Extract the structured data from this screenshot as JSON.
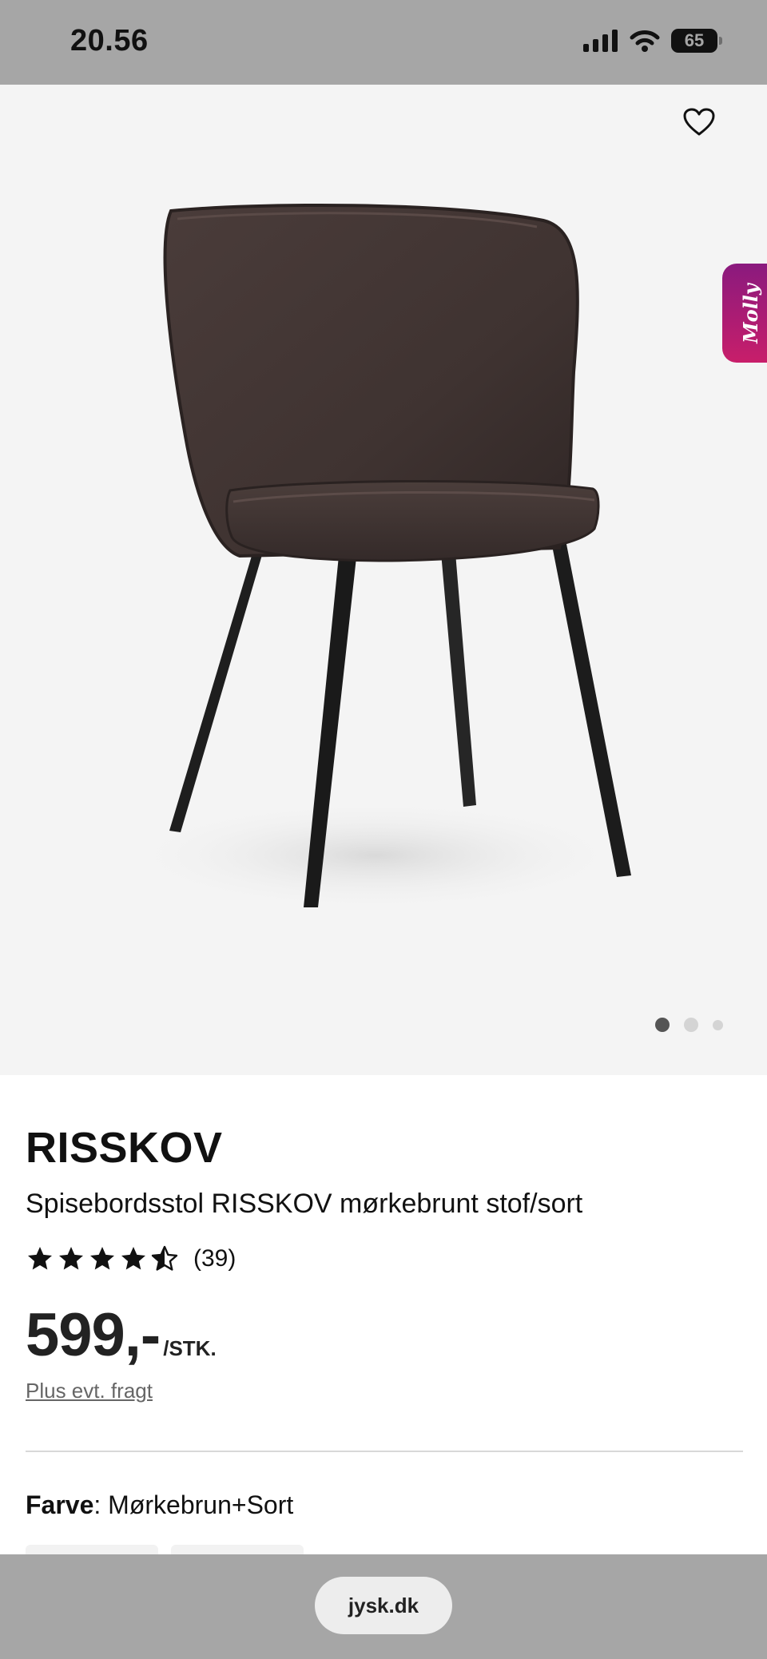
{
  "status_bar": {
    "time": "20.56",
    "battery_level": "65"
  },
  "product": {
    "name": "RISSKOV",
    "subtitle": "Spisebordsstol RISSKOV mørkebrunt stof/sort",
    "rating": 4.5,
    "rating_max": 5,
    "review_count": "(39)",
    "price": "599,-",
    "price_unit": "/STK.",
    "shipping_note": "Plus evt. fragt",
    "color_label": "Farve",
    "color_value": ": Mørkebrun+Sort"
  },
  "gallery": {
    "image_count": 3,
    "active_index": 0
  },
  "chat_widget": {
    "label": "Molly"
  },
  "browser": {
    "url": "jysk.dk"
  },
  "colors": {
    "status_bg": "#a6a6a6",
    "hero_bg": "#f4f4f4",
    "molly_start": "#8a1a7e",
    "molly_end": "#c81e6a"
  },
  "icons": [
    "signal-icon",
    "wifi-icon",
    "battery-icon",
    "heart-icon",
    "star-icon",
    "half-star-icon"
  ]
}
